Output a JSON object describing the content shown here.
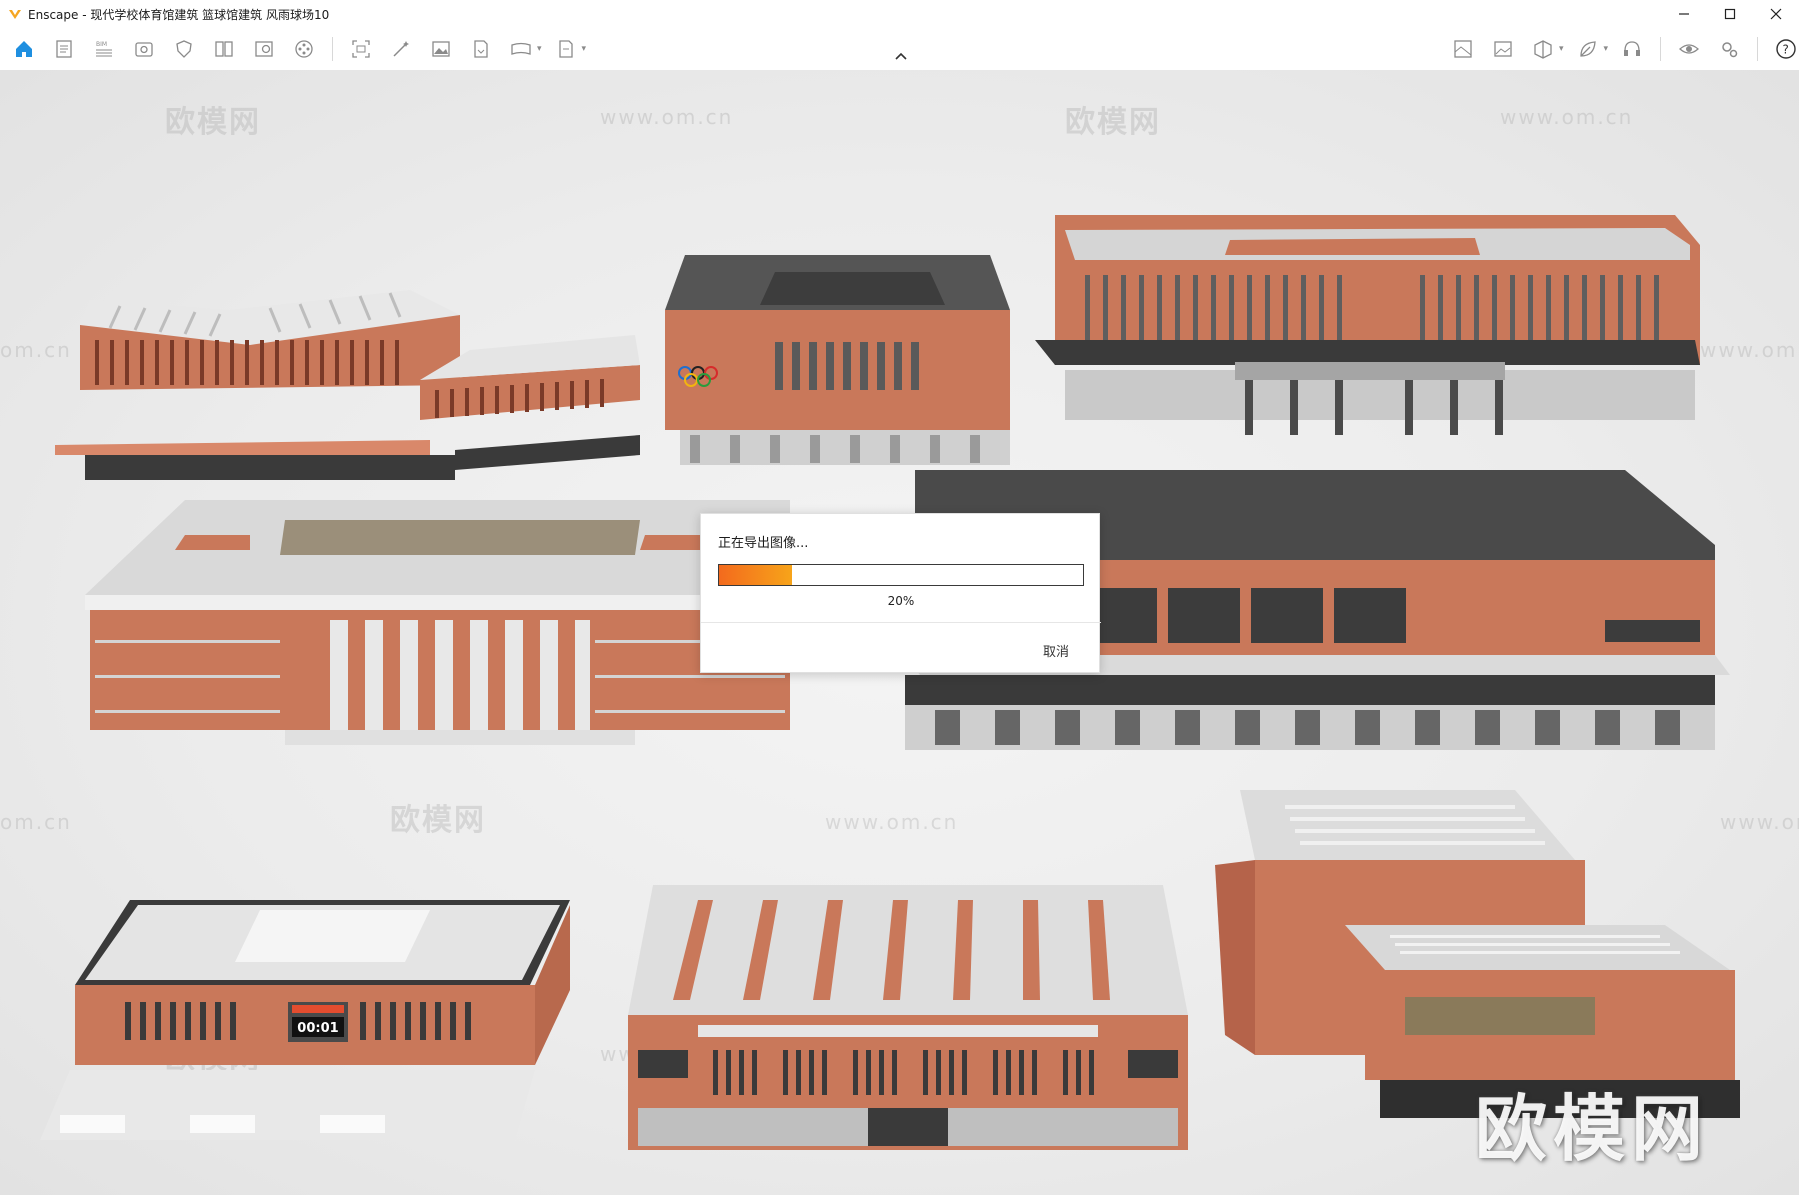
{
  "window": {
    "title": "Enscape - 现代学校体育馆建筑 篮球馆建筑 风雨球场10",
    "controls": [
      "minimize",
      "maximize",
      "close"
    ]
  },
  "toolbar": {
    "left_icons": [
      "home-icon",
      "document-icon",
      "bim-icon",
      "view-icon",
      "shield-icon",
      "book-icon",
      "asset-icon",
      "film-icon",
      "screenshot-icon",
      "magic-icon",
      "image-icon",
      "export-icon",
      "panorama-icon",
      "batch-icon"
    ],
    "right_icons": [
      "map-icon",
      "picture-icon",
      "cube-icon",
      "leaf-icon",
      "headset-icon",
      "eye-icon",
      "settings-icon",
      "help-icon"
    ],
    "accent_color": "#1f8fe0"
  },
  "watermarks": {
    "brand_cn": "欧模网",
    "url": "www.om.cn",
    "url_short": "om.cn"
  },
  "scoreboard": {
    "time": "00:01"
  },
  "dialog": {
    "title": "正在导出图像...",
    "progress_percent": 20,
    "progress_text": "20%",
    "cancel_label": "取消"
  },
  "brand_logo_text": "欧模网"
}
